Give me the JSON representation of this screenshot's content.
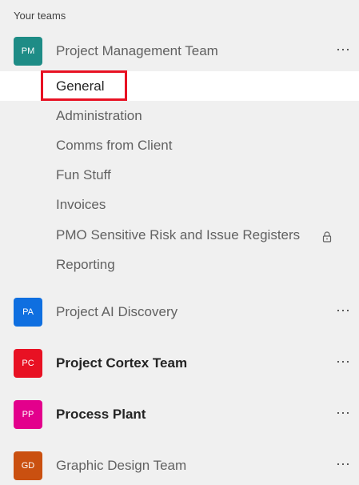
{
  "sidebar": {
    "section_title": "Your teams",
    "teams": [
      {
        "initials": "PM",
        "name": "Project Management Team",
        "color": "#1e8c86",
        "more": "···",
        "channels": [
          {
            "label": "General",
            "selected": true
          },
          {
            "label": "Administration"
          },
          {
            "label": "Comms from Client"
          },
          {
            "label": "Fun Stuff"
          },
          {
            "label": "Invoices"
          },
          {
            "label": "PMO Sensitive Risk and Issue Registers",
            "private": true
          },
          {
            "label": "Reporting"
          }
        ]
      },
      {
        "initials": "PA",
        "name": "Project AI Discovery",
        "color": "#0f6fe0",
        "more": "···"
      },
      {
        "initials": "PC",
        "name": "Project Cortex Team",
        "color": "#e81123",
        "bold": true,
        "more": "···"
      },
      {
        "initials": "PP",
        "name": "Process Plant",
        "color": "#e3008c",
        "bold": true,
        "more": "···"
      },
      {
        "initials": "GD",
        "name": "Graphic Design Team",
        "color": "#ca5010",
        "more": "···"
      }
    ]
  }
}
